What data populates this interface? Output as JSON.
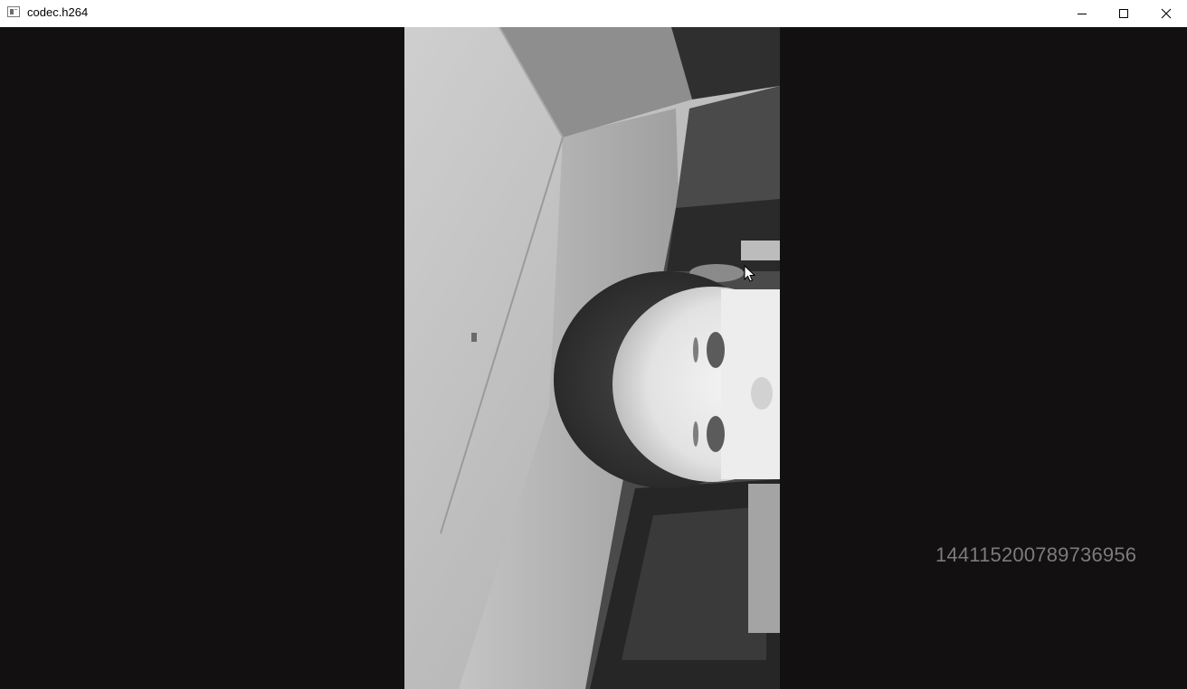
{
  "window": {
    "title": "codec.h264",
    "app_icon": "window-app-icon",
    "controls": {
      "minimize_icon": "minimize-icon",
      "maximize_icon": "maximize-icon",
      "close_icon": "close-icon"
    }
  },
  "video": {
    "overlay_text": "144115200789736956",
    "colors": {
      "background": "#121011",
      "overlay_text": "#7c7c7c"
    }
  }
}
